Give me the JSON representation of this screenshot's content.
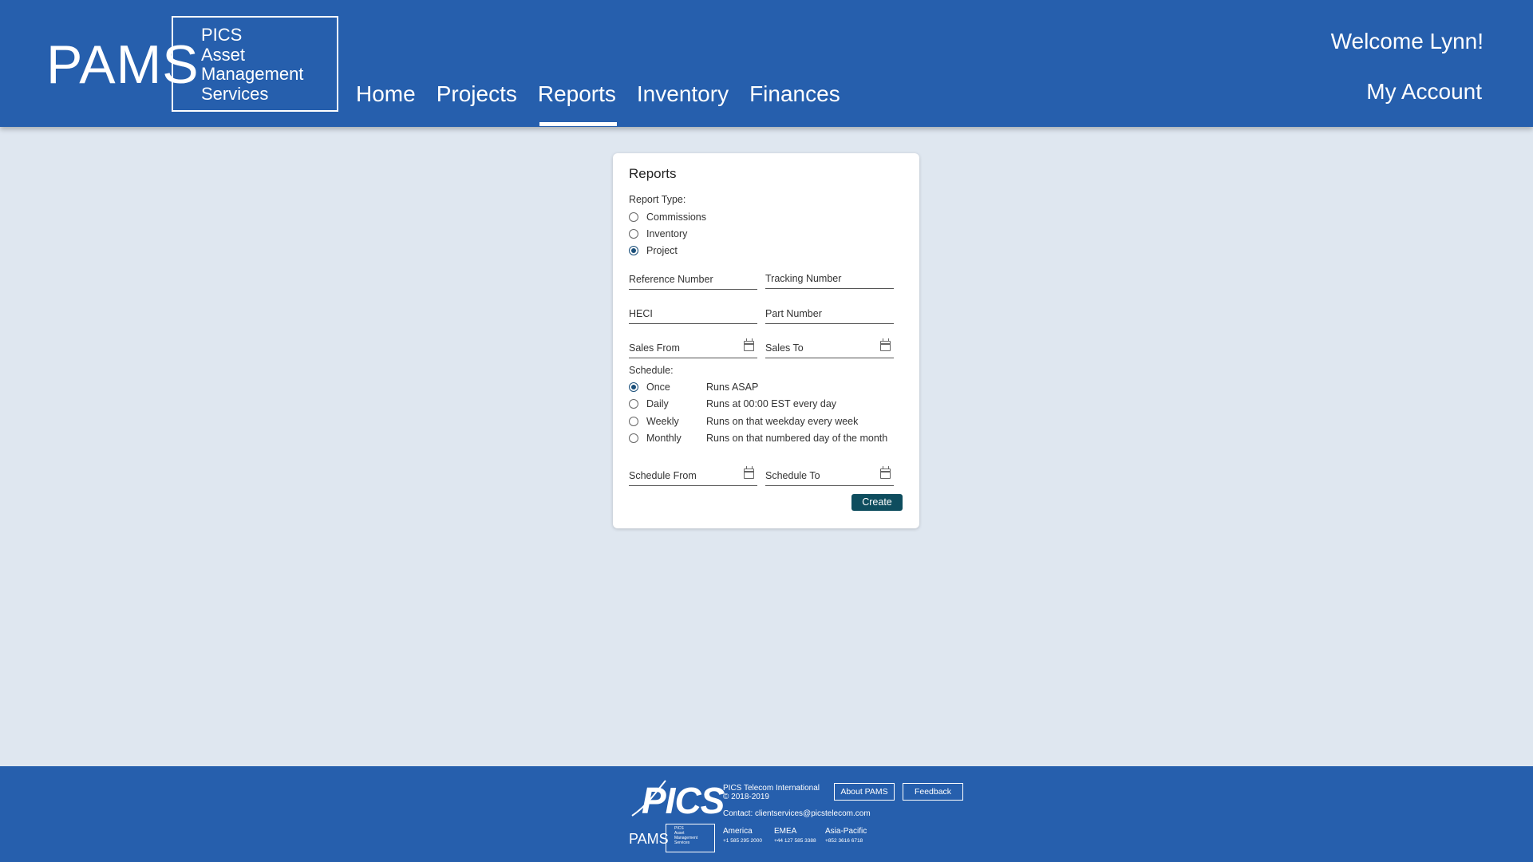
{
  "header": {
    "logo_main": "PAMS",
    "logo_lines": [
      "PICS",
      "Asset",
      "Management",
      "Services"
    ],
    "nav": [
      "Home",
      "Projects",
      "Reports",
      "Inventory",
      "Finances"
    ],
    "active_nav": "Reports",
    "welcome": "Welcome Lynn!",
    "account": "My Account"
  },
  "card": {
    "title": "Reports",
    "report_type_label": "Report Type:",
    "report_types": [
      {
        "label": "Commissions",
        "checked": false
      },
      {
        "label": "Inventory",
        "checked": false
      },
      {
        "label": "Project",
        "checked": true
      }
    ],
    "fields": {
      "reference_number": "Reference Number",
      "tracking_number": "Tracking Number",
      "heci": "HECI",
      "part_number": "Part Number",
      "sales_from": "Sales From",
      "sales_to": "Sales To",
      "schedule_from": "Schedule From",
      "schedule_to": "Schedule To"
    },
    "schedule_label": "Schedule:",
    "schedules": [
      {
        "name": "Once",
        "desc": "Runs ASAP",
        "checked": true
      },
      {
        "name": "Daily",
        "desc": "Runs at 00:00 EST every day",
        "checked": false
      },
      {
        "name": "Weekly",
        "desc": "Runs on that weekday every week",
        "checked": false
      },
      {
        "name": "Monthly",
        "desc": "Runs on that numbered day of the month",
        "checked": false
      }
    ],
    "create_button": "Create"
  },
  "footer": {
    "pics_logo": "PICS",
    "company": "PICS Telecom International",
    "copyright": "© 2018-2019",
    "about_button": "About PAMS",
    "feedback_button": "Feedback",
    "contact": "Contact: clientservices@picstelecom.com",
    "mini_logo": "PAMS",
    "mini_logo_lines": [
      "PICS",
      "Asset",
      "Management",
      "Services"
    ],
    "regions": [
      {
        "name": "America",
        "phone": "+1 585 295 2000"
      },
      {
        "name": "EMEA",
        "phone": "+44 127 585 3388"
      },
      {
        "name": "Asia-Pacific",
        "phone": "+852 3616 6718"
      }
    ]
  },
  "colors": {
    "brand_blue": "#265fad",
    "page_bg": "#dfe7f0",
    "button_teal": "#0e4d5e"
  }
}
